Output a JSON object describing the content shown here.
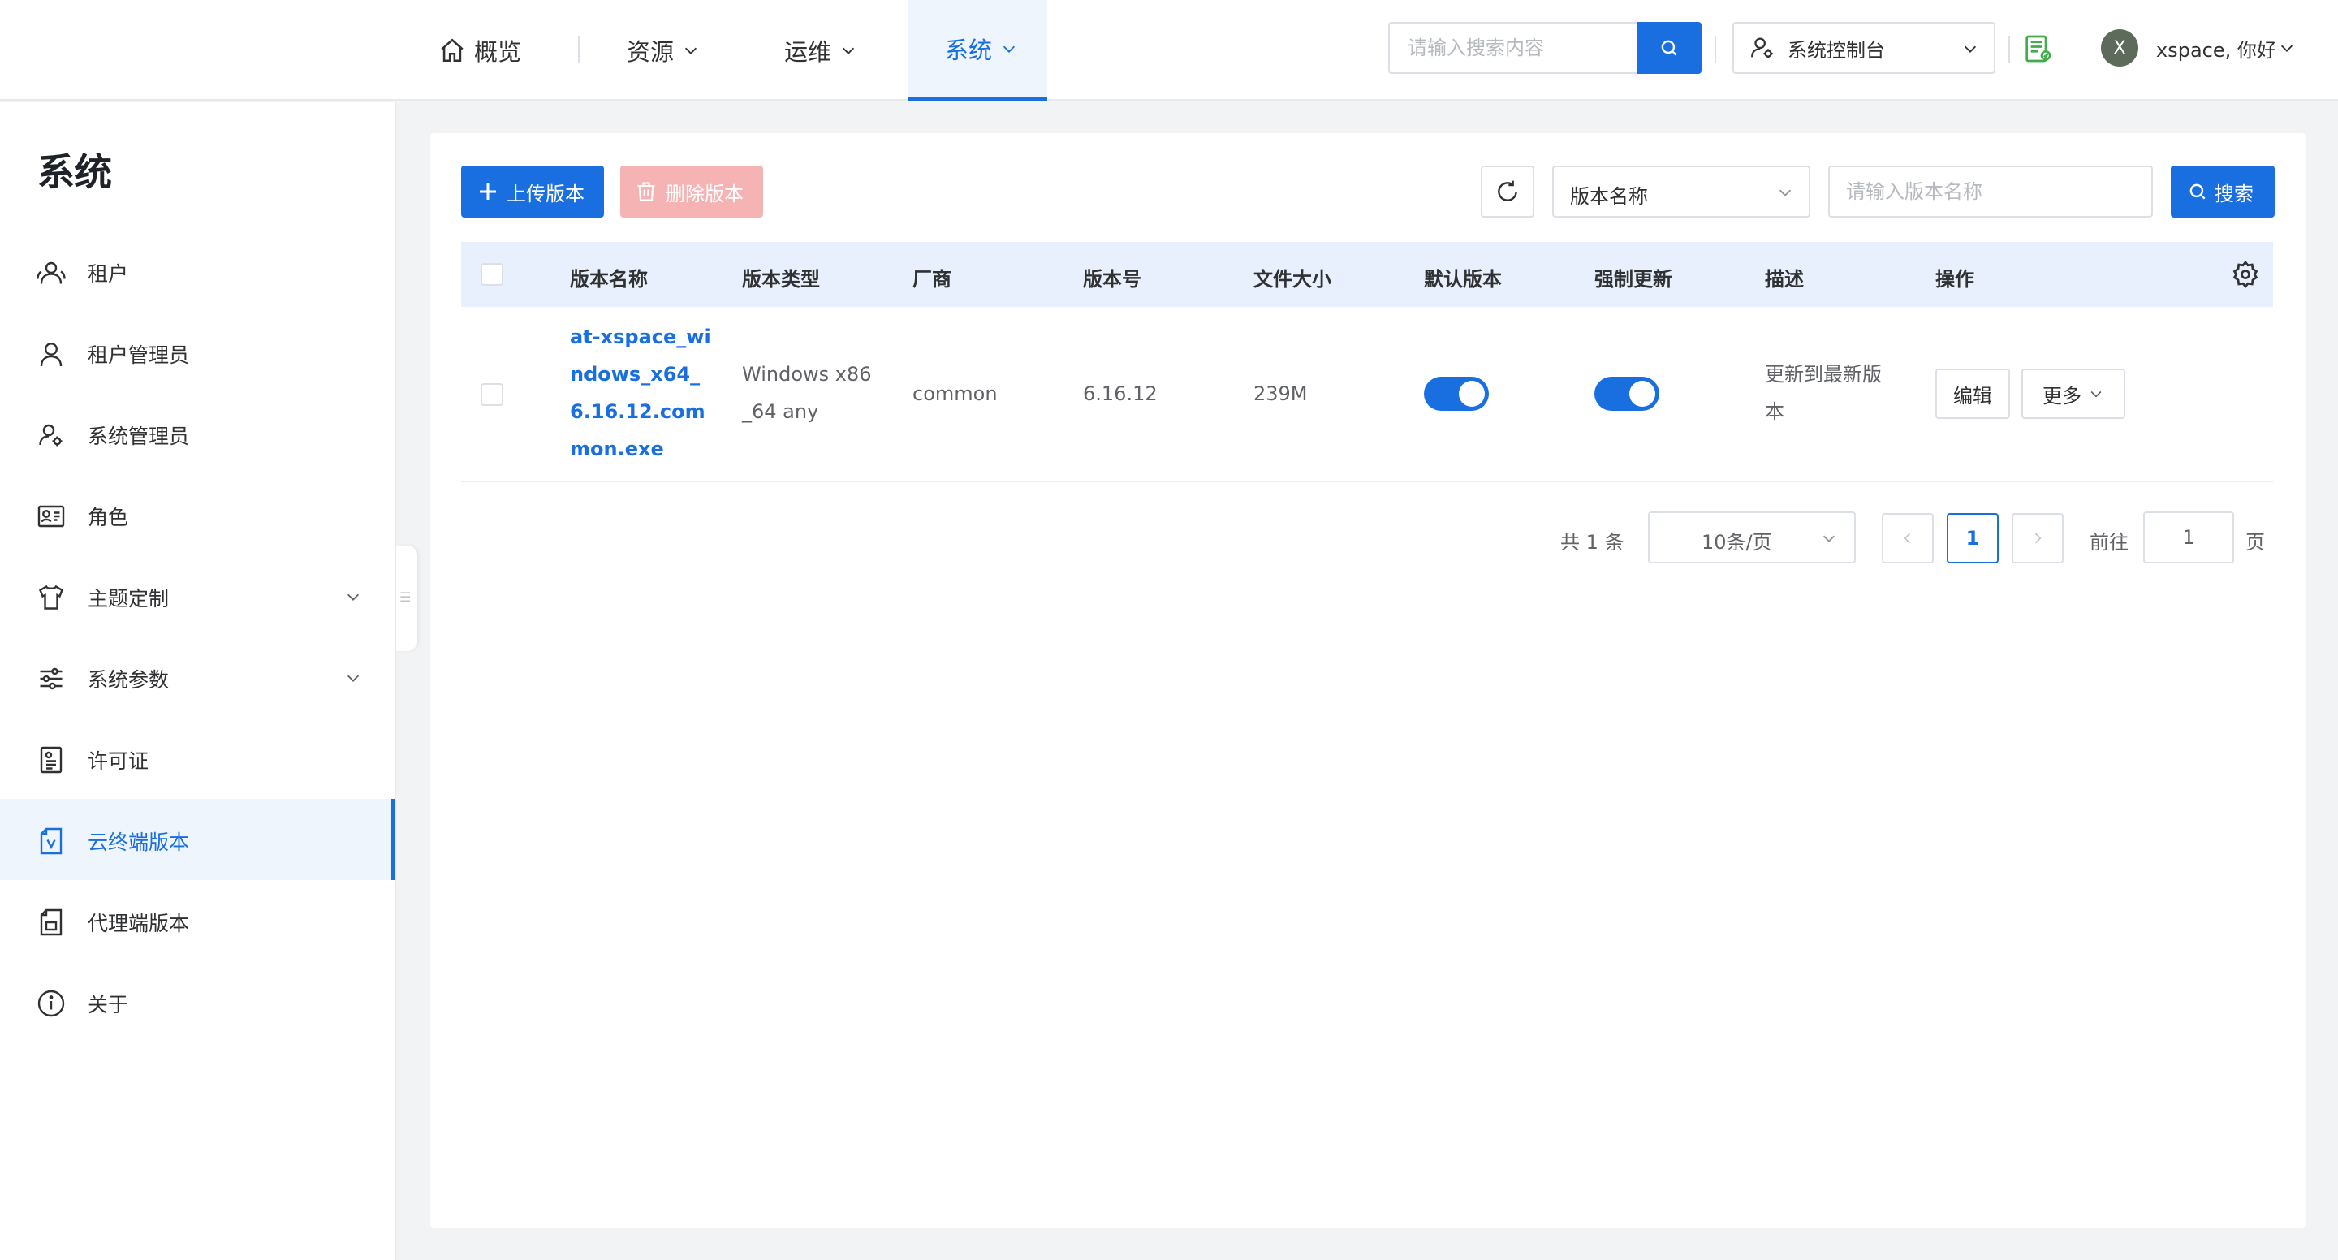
{
  "nav": {
    "home": "概览",
    "resources": "资源",
    "ops": "运维",
    "system": "系统"
  },
  "header": {
    "search_placeholder": "请输入搜索内容",
    "console": "系统控制台",
    "avatar_letter": "X",
    "greeting": "xspace, 你好"
  },
  "sidebar": {
    "title": "系统",
    "items": [
      {
        "label": "租户"
      },
      {
        "label": "租户管理员"
      },
      {
        "label": "系统管理员"
      },
      {
        "label": "角色"
      },
      {
        "label": "主题定制"
      },
      {
        "label": "系统参数"
      },
      {
        "label": "许可证"
      },
      {
        "label": "云终端版本"
      },
      {
        "label": "代理端版本"
      },
      {
        "label": "关于"
      }
    ]
  },
  "toolbar": {
    "upload": "上传版本",
    "delete": "删除版本",
    "filter_field": "版本名称",
    "filter_placeholder": "请输入版本名称",
    "search": "搜索"
  },
  "table": {
    "headers": [
      "版本名称",
      "版本类型",
      "厂商",
      "版本号",
      "文件大小",
      "默认版本",
      "强制更新",
      "描述",
      "操作"
    ],
    "rows": [
      {
        "name_lines": [
          "at-xspace_wi",
          "ndows_x64_",
          "6.16.12.com",
          "mon.exe"
        ],
        "type_lines": [
          "Windows x86",
          "_64 any"
        ],
        "vendor": "common",
        "version": "6.16.12",
        "size": "239M",
        "default_version": true,
        "force_update": true,
        "desc_lines": [
          "更新到最新版",
          "本"
        ],
        "edit": "编辑",
        "more": "更多"
      }
    ]
  },
  "pagination": {
    "total": "共 1 条",
    "page_size": "10条/页",
    "current": "1",
    "goto_label": "前往",
    "goto_value": "1",
    "page_suffix": "页"
  },
  "colors": {
    "primary": "#1a6fe0",
    "danger_disabled": "#f5b3b3",
    "table_header_bg": "#e7f0fc"
  }
}
